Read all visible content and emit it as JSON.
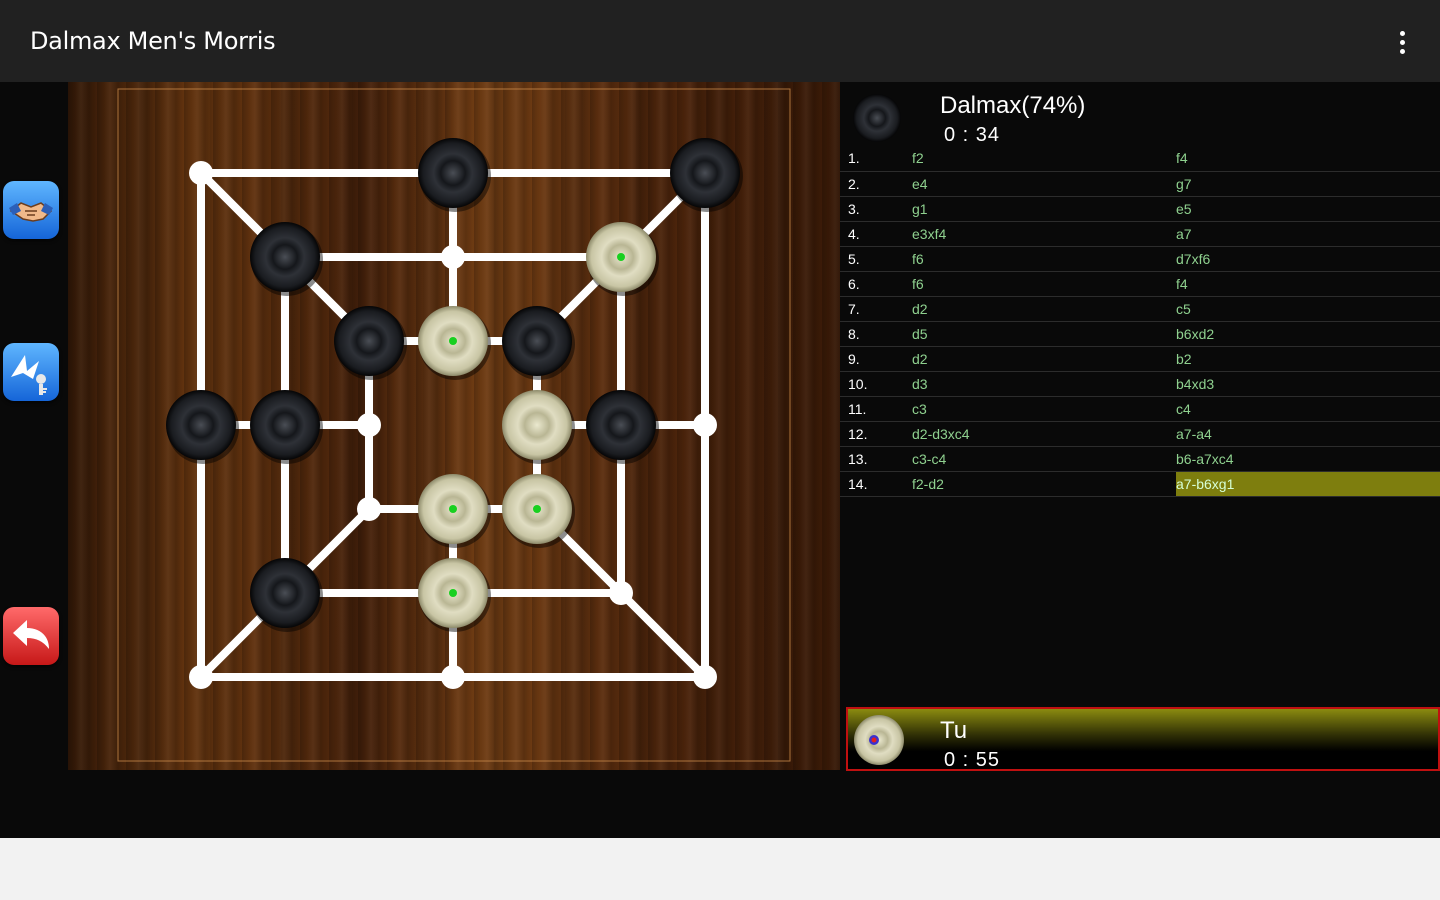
{
  "app": {
    "title": "Dalmax Men's Morris",
    "menu_icon": "more-vert-icon"
  },
  "sidebar": {
    "buttons": [
      {
        "id": "draw",
        "icon": "handshake-icon",
        "color": "#1e7be6"
      },
      {
        "id": "hint",
        "icon": "hint-icon",
        "color": "#1e7be6"
      },
      {
        "id": "undo",
        "icon": "undo-icon",
        "color": "#e02626"
      }
    ]
  },
  "opponent": {
    "name": "Dalmax(74%)",
    "time": "0 : 34",
    "piece": "black"
  },
  "player": {
    "name": "Tu",
    "time": "0 : 55",
    "piece": "white",
    "active": true
  },
  "moves": [
    {
      "num": "1.",
      "white": "f2",
      "black": "f4"
    },
    {
      "num": "2.",
      "white": "e4",
      "black": "g7"
    },
    {
      "num": "3.",
      "white": "g1",
      "black": "e5"
    },
    {
      "num": "4.",
      "white": "e3xf4",
      "black": "a7"
    },
    {
      "num": "5.",
      "white": "f6",
      "black": "d7xf6"
    },
    {
      "num": "6.",
      "white": "f6",
      "black": "f4"
    },
    {
      "num": "7.",
      "white": "d2",
      "black": "c5"
    },
    {
      "num": "8.",
      "white": "d5",
      "black": "b6xd2"
    },
    {
      "num": "9.",
      "white": "d2",
      "black": "b2"
    },
    {
      "num": "10.",
      "white": "d3",
      "black": "b4xd3"
    },
    {
      "num": "11.",
      "white": "c3",
      "black": "c4"
    },
    {
      "num": "12.",
      "white": "d2-d3xc4",
      "black": "a7-a4"
    },
    {
      "num": "13.",
      "white": "c3-c4",
      "black": "b6-a7xc4"
    },
    {
      "num": "14.",
      "white": "f2-d2",
      "black": "a7-b6xg1"
    }
  ],
  "current_move_index": 13,
  "board": {
    "points": {
      "a7": "empty",
      "d7": "black",
      "g7": "black",
      "b6": "black",
      "d6": "empty",
      "f6": "white",
      "c5": "black",
      "d5": "white",
      "e5": "black",
      "a4": "black",
      "b4": "black",
      "c4": "empty",
      "e4": "white",
      "f4": "black",
      "g4": "empty",
      "c3": "empty",
      "d3": "white",
      "e3": "white",
      "b2": "black",
      "d2": "white",
      "f2": "empty",
      "a1": "empty",
      "d1": "empty",
      "g1": "empty"
    },
    "selectable_marks": [
      "f6",
      "d5",
      "d3",
      "e3",
      "d2"
    ],
    "colors": {
      "black_piece": "#1c1c20",
      "white_piece": "#d8d6b8",
      "line": "#ffffff",
      "mark": "#18d020"
    }
  }
}
